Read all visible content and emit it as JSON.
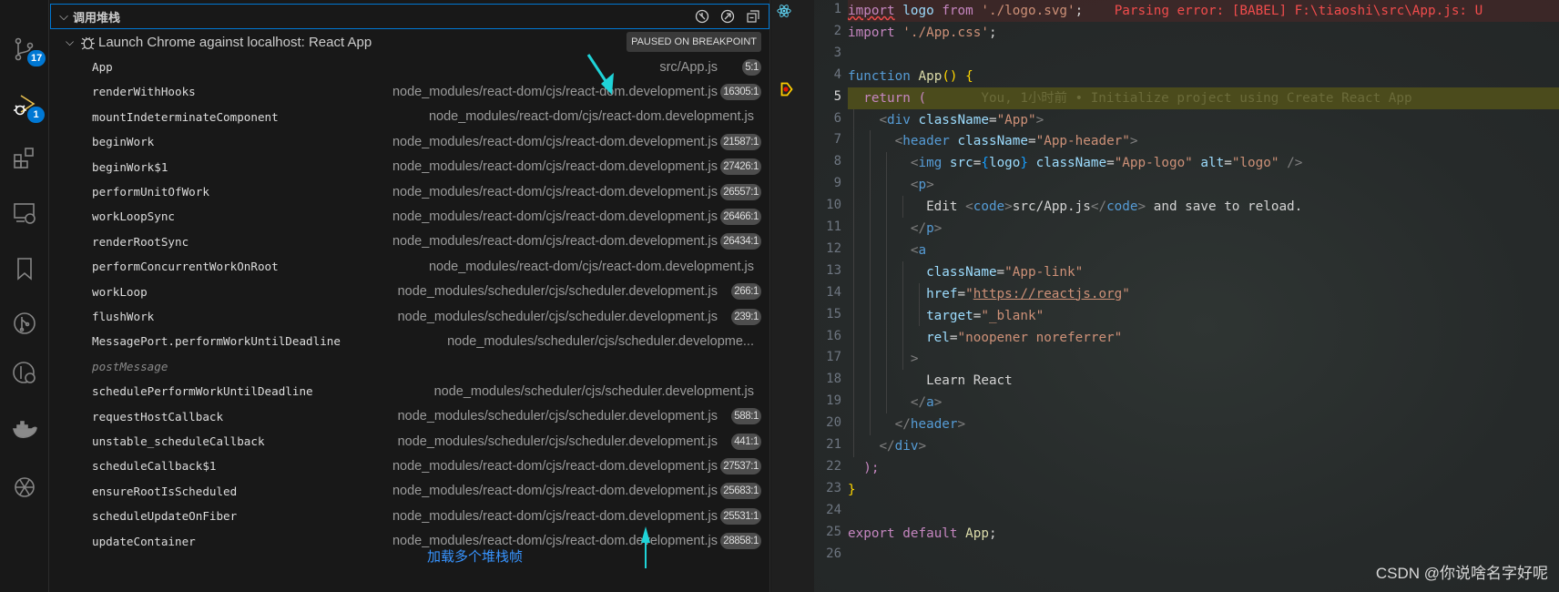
{
  "activity_bar": {
    "items": [
      {
        "icon": "source-control-icon",
        "badge": "17"
      },
      {
        "icon": "run-debug-icon",
        "badge": "1"
      },
      {
        "icon": "extensions-icon"
      },
      {
        "icon": "remote-explorer-icon"
      },
      {
        "icon": "bookmark-icon"
      },
      {
        "icon": "git-graph-icon"
      },
      {
        "icon": "git-history-icon"
      },
      {
        "icon": "docker-icon"
      },
      {
        "icon": "openai-icon"
      }
    ]
  },
  "call_stack": {
    "title": "调用堆栈",
    "session": "Launch Chrome against localhost: React App",
    "status": "PAUSED ON BREAKPOINT",
    "frames": [
      {
        "name": "App",
        "file": "src/App.js",
        "line": "5:1"
      },
      {
        "name": "renderWithHooks",
        "file": "node_modules/react-dom/cjs/react-dom.development.js",
        "line": "16305:1"
      },
      {
        "name": "mountIndeterminateComponent",
        "file": "node_modules/react-dom/cjs/react-dom.development.js",
        "line": ""
      },
      {
        "name": "beginWork",
        "file": "node_modules/react-dom/cjs/react-dom.development.js",
        "line": "21587:1"
      },
      {
        "name": "beginWork$1",
        "file": "node_modules/react-dom/cjs/react-dom.development.js",
        "line": "27426:1"
      },
      {
        "name": "performUnitOfWork",
        "file": "node_modules/react-dom/cjs/react-dom.development.js",
        "line": "26557:1"
      },
      {
        "name": "workLoopSync",
        "file": "node_modules/react-dom/cjs/react-dom.development.js",
        "line": "26466:1"
      },
      {
        "name": "renderRootSync",
        "file": "node_modules/react-dom/cjs/react-dom.development.js",
        "line": "26434:1"
      },
      {
        "name": "performConcurrentWorkOnRoot",
        "file": "node_modules/react-dom/cjs/react-dom.development.js",
        "line": ""
      },
      {
        "name": "workLoop",
        "file": "node_modules/scheduler/cjs/scheduler.development.js",
        "line": "266:1"
      },
      {
        "name": "flushWork",
        "file": "node_modules/scheduler/cjs/scheduler.development.js",
        "line": "239:1"
      },
      {
        "name": "MessagePort.performWorkUntilDeadline",
        "file": "node_modules/scheduler/cjs/scheduler.developme...",
        "line": ""
      },
      {
        "name": "postMessage",
        "file": "",
        "line": "",
        "label": true
      },
      {
        "name": "schedulePerformWorkUntilDeadline",
        "file": "node_modules/scheduler/cjs/scheduler.development.js",
        "line": ""
      },
      {
        "name": "requestHostCallback",
        "file": "node_modules/scheduler/cjs/scheduler.development.js",
        "line": "588:1"
      },
      {
        "name": "unstable_scheduleCallback",
        "file": "node_modules/scheduler/cjs/scheduler.development.js",
        "line": "441:1"
      },
      {
        "name": "scheduleCallback$1",
        "file": "node_modules/react-dom/cjs/react-dom.development.js",
        "line": "27537:1"
      },
      {
        "name": "ensureRootIsScheduled",
        "file": "node_modules/react-dom/cjs/react-dom.development.js",
        "line": "25683:1"
      },
      {
        "name": "scheduleUpdateOnFiber",
        "file": "node_modules/react-dom/cjs/react-dom.development.js",
        "line": "25531:1"
      },
      {
        "name": "updateContainer",
        "file": "node_modules/react-dom/cjs/react-dom.development.js",
        "line": "28858:1"
      }
    ],
    "annotation": "加载多个堆栈帧"
  },
  "editor": {
    "current_line": 5,
    "lines": [
      [
        [
          "import",
          "kw"
        ],
        [
          " "
        ],
        [
          "logo",
          "var"
        ],
        [
          " "
        ],
        [
          "from",
          "kw"
        ],
        [
          " "
        ],
        [
          "'./logo.svg'",
          "str"
        ],
        [
          ";",
          "txt"
        ],
        [
          "    Parsing error: [BABEL] F:\\tiaoshi\\src\\App.js: U",
          "error"
        ]
      ],
      [
        [
          "import",
          "kw"
        ],
        [
          " "
        ],
        [
          "'./App.css'",
          "str"
        ],
        [
          ";",
          "txt"
        ]
      ],
      [],
      [
        [
          "function",
          "tag"
        ],
        [
          " "
        ],
        [
          "App",
          "fn"
        ],
        [
          "()",
          "br"
        ],
        [
          " "
        ],
        [
          "{",
          "br"
        ]
      ],
      [
        [
          "  "
        ],
        [
          "return",
          "kw"
        ],
        [
          " "
        ],
        [
          "(",
          "kw"
        ],
        [
          "       You, 1小时前 • Initialize project using Create React App",
          "blame"
        ]
      ],
      [
        [
          "    "
        ],
        [
          "<",
          "pun"
        ],
        [
          "div",
          "tag"
        ],
        [
          " "
        ],
        [
          "className",
          "var"
        ],
        [
          "=",
          "txt"
        ],
        [
          "\"App\"",
          "str"
        ],
        [
          ">",
          "pun"
        ]
      ],
      [
        [
          "      "
        ],
        [
          "<",
          "pun"
        ],
        [
          "header",
          "tag"
        ],
        [
          " "
        ],
        [
          "className",
          "var"
        ],
        [
          "=",
          "txt"
        ],
        [
          "\"App-header\"",
          "str"
        ],
        [
          ">",
          "pun"
        ]
      ],
      [
        [
          "        "
        ],
        [
          "<",
          "pun"
        ],
        [
          "img",
          "tag"
        ],
        [
          " "
        ],
        [
          "src",
          "var"
        ],
        [
          "=",
          "txt"
        ],
        [
          "{",
          "br2"
        ],
        [
          "logo",
          "var"
        ],
        [
          "}",
          "br2"
        ],
        [
          " "
        ],
        [
          "className",
          "var"
        ],
        [
          "=",
          "txt"
        ],
        [
          "\"App-logo\"",
          "str"
        ],
        [
          " "
        ],
        [
          "alt",
          "var"
        ],
        [
          "=",
          "txt"
        ],
        [
          "\"logo\"",
          "str"
        ],
        [
          " />",
          "pun"
        ]
      ],
      [
        [
          "        "
        ],
        [
          "<",
          "pun"
        ],
        [
          "p",
          "tag"
        ],
        [
          ">",
          "pun"
        ]
      ],
      [
        [
          "          "
        ],
        [
          "Edit ",
          "txt"
        ],
        [
          "<",
          "pun"
        ],
        [
          "code",
          "tag"
        ],
        [
          ">",
          "pun"
        ],
        [
          "src/App.js",
          "txt"
        ],
        [
          "</",
          "pun"
        ],
        [
          "code",
          "tag"
        ],
        [
          ">",
          "pun"
        ],
        [
          " and save to reload.",
          "txt"
        ]
      ],
      [
        [
          "        "
        ],
        [
          "</",
          "pun"
        ],
        [
          "p",
          "tag"
        ],
        [
          ">",
          "pun"
        ]
      ],
      [
        [
          "        "
        ],
        [
          "<",
          "pun"
        ],
        [
          "a",
          "tag"
        ]
      ],
      [
        [
          "          "
        ],
        [
          "className",
          "var"
        ],
        [
          "=",
          "txt"
        ],
        [
          "\"App-link\"",
          "str"
        ]
      ],
      [
        [
          "          "
        ],
        [
          "href",
          "var"
        ],
        [
          "=",
          "txt"
        ],
        [
          "\"",
          "str"
        ],
        [
          "https://reactjs.org",
          "link"
        ],
        [
          "\"",
          "str"
        ]
      ],
      [
        [
          "          "
        ],
        [
          "target",
          "var"
        ],
        [
          "=",
          "txt"
        ],
        [
          "\"_blank\"",
          "str"
        ]
      ],
      [
        [
          "          "
        ],
        [
          "rel",
          "var"
        ],
        [
          "=",
          "txt"
        ],
        [
          "\"noopener noreferrer\"",
          "str"
        ]
      ],
      [
        [
          "        "
        ],
        [
          ">",
          "pun"
        ]
      ],
      [
        [
          "          "
        ],
        [
          "Learn React",
          "txt"
        ]
      ],
      [
        [
          "        "
        ],
        [
          "</",
          "pun"
        ],
        [
          "a",
          "tag"
        ],
        [
          ">",
          "pun"
        ]
      ],
      [
        [
          "      "
        ],
        [
          "</",
          "pun"
        ],
        [
          "header",
          "tag"
        ],
        [
          ">",
          "pun"
        ]
      ],
      [
        [
          "    "
        ],
        [
          "</",
          "pun"
        ],
        [
          "div",
          "tag"
        ],
        [
          ">",
          "pun"
        ]
      ],
      [
        [
          "  "
        ],
        [
          ");",
          "kw"
        ]
      ],
      [
        [
          "}",
          "br"
        ]
      ],
      [],
      [
        [
          "export",
          "kw"
        ],
        [
          " "
        ],
        [
          "default",
          "kw"
        ],
        [
          " "
        ],
        [
          "App",
          "fn"
        ],
        [
          ";",
          "txt"
        ]
      ],
      []
    ]
  },
  "watermark": "CSDN @你说啥名字好呢",
  "colors": {
    "accent": "#0078d4",
    "annotation": "#3794ff",
    "arrow": "#1fd3d8"
  }
}
